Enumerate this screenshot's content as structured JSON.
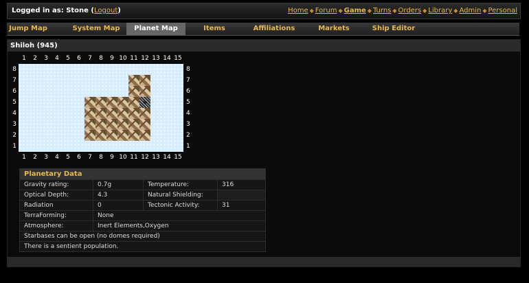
{
  "header": {
    "login_prefix": "Logged in as: Stone",
    "logout_label": "Logout",
    "nav": [
      "Home",
      "Forum",
      "Game",
      "Turns",
      "Orders",
      "Library",
      "Admin",
      "Personal"
    ],
    "active_nav": "Game"
  },
  "tabs": [
    "Jump Map",
    "System Map",
    "Planet Map",
    "Items",
    "Affiliations",
    "Markets",
    "Ship Editor"
  ],
  "active_tab": "Planet Map",
  "planet": {
    "title": "Shiloh (945)",
    "x_labels": [
      "1",
      "2",
      "3",
      "4",
      "5",
      "6",
      "7",
      "8",
      "9",
      "10",
      "11",
      "12",
      "13",
      "14",
      "15"
    ],
    "y_labels": [
      "8",
      "7",
      "6",
      "5",
      "4",
      "3",
      "2",
      "1"
    ],
    "land_tiles": [
      [
        11,
        7
      ],
      [
        12,
        7
      ],
      [
        11,
        6
      ],
      [
        12,
        6
      ],
      [
        7,
        5
      ],
      [
        8,
        5
      ],
      [
        9,
        5
      ],
      [
        10,
        5
      ],
      [
        11,
        5
      ],
      [
        7,
        4
      ],
      [
        8,
        4
      ],
      [
        9,
        4
      ],
      [
        10,
        4
      ],
      [
        11,
        4
      ],
      [
        12,
        4
      ],
      [
        7,
        3
      ],
      [
        8,
        3
      ],
      [
        9,
        3
      ],
      [
        10,
        3
      ],
      [
        11,
        3
      ],
      [
        12,
        3
      ],
      [
        7,
        2
      ],
      [
        8,
        2
      ],
      [
        9,
        2
      ],
      [
        10,
        2
      ],
      [
        11,
        2
      ],
      [
        12,
        2
      ]
    ],
    "marker_tile": [
      12,
      5
    ]
  },
  "planetary_data": {
    "heading": "Planetary Data",
    "gravity_label": "Gravity rating:",
    "gravity_value": "0.7g",
    "temperature_label": "Temperature:",
    "temperature_value": "316",
    "optical_label": "Optical Depth:",
    "optical_value": "4.3",
    "shielding_label": "Natural Shielding:",
    "shielding_value": "",
    "radiation_label": "Radiation",
    "radiation_value": "0",
    "tectonic_label": "Tectonic Activity:",
    "tectonic_value": "31",
    "terraforming_label": "TerraForming:",
    "terraforming_value": "None",
    "atmosphere_label": "Atmosphere:",
    "atmosphere_value": "Inert Elements,Oxygen",
    "starbase_note": "Starbases can be open (no domes required)",
    "sentient_note": "There is a sentient population."
  }
}
